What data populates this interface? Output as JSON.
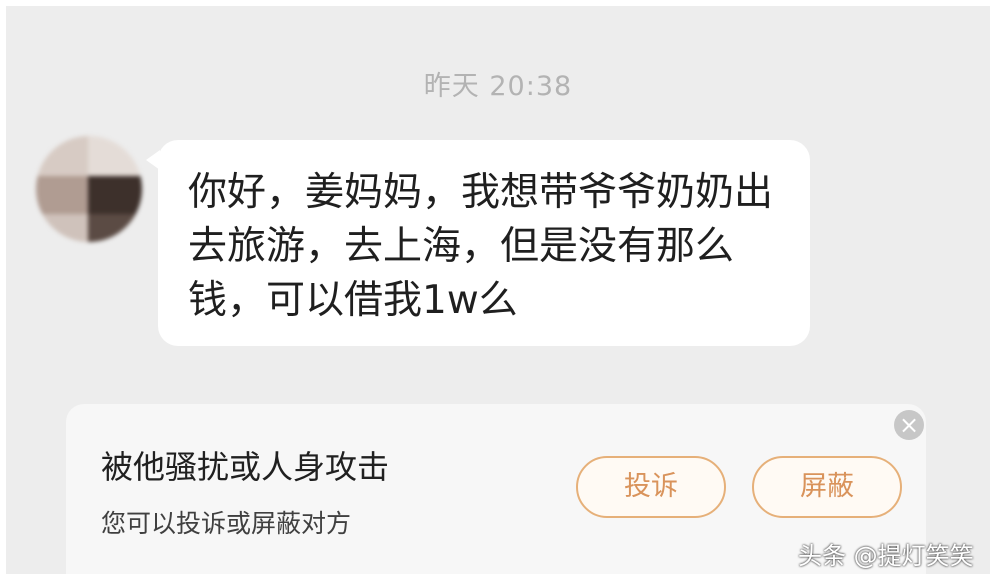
{
  "chat": {
    "timestamp": "昨天 20:38",
    "message": "你好，姜妈妈，我想带爷爷奶奶出去旅游，去上海，但是没有那么钱，可以借我1w么"
  },
  "report": {
    "title": "被他骚扰或人身攻击",
    "subtitle": "您可以投诉或屏蔽对方",
    "complain_label": "投诉",
    "block_label": "屏蔽",
    "close_icon": "close-icon",
    "accent": "#d9935b"
  },
  "watermark": {
    "text": "头条 @提灯笑笑"
  }
}
